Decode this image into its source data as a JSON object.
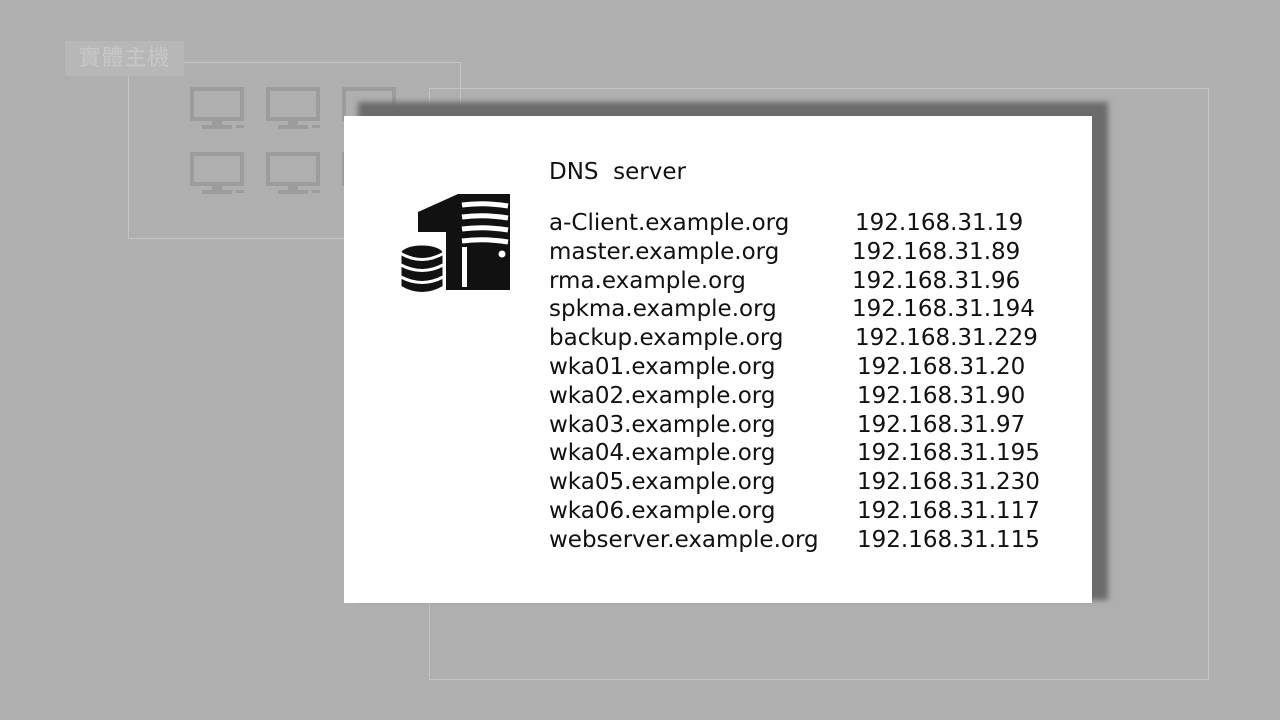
{
  "background": {
    "host_group_label": "實體主機",
    "monitors": [
      "monitor-icon",
      "monitor-icon",
      "monitor-icon",
      "monitor-icon",
      "monitor-icon",
      "monitor-icon"
    ]
  },
  "dns_card": {
    "title": "DNS  server",
    "icon": "server-database-icon",
    "records": [
      {
        "host": "a-Client.example.org",
        "ip": "192.168.31.19"
      },
      {
        "host": "master.example.org",
        "ip": "192.168.31.89"
      },
      {
        "host": "rma.example.org",
        "ip": "192.168.31.96"
      },
      {
        "host": "spkma.example.org",
        "ip": "192.168.31.194"
      },
      {
        "host": "backup.example.org",
        "ip": "192.168.31.229"
      },
      {
        "host": "wka01.example.org",
        "ip": "192.168.31.20"
      },
      {
        "host": "wka02.example.org",
        "ip": "192.168.31.90"
      },
      {
        "host": "wka03.example.org",
        "ip": "192.168.31.97"
      },
      {
        "host": "wka04.example.org",
        "ip": "192.168.31.195"
      },
      {
        "host": "wka05.example.org",
        "ip": "192.168.31.230"
      },
      {
        "host": "wka06.example.org",
        "ip": "192.168.31.117"
      },
      {
        "host": "webserver.example.org",
        "ip": "192.168.31.115"
      }
    ]
  },
  "colors": {
    "background": "#afafaf",
    "card": "#ffffff",
    "shadow": "#6b6b6b",
    "icon": "#111111",
    "dim_icon": "#9c9c9c"
  }
}
